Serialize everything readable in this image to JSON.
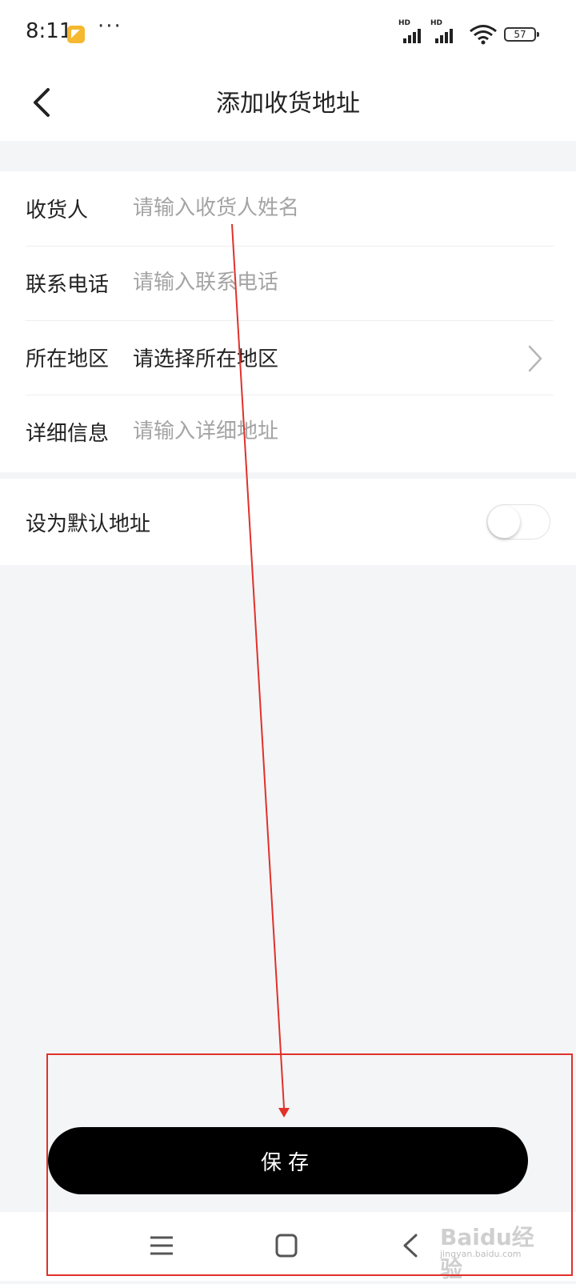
{
  "status_bar": {
    "time": "8:11",
    "dots": "···",
    "signal_label": "HD",
    "battery": "57"
  },
  "header": {
    "title": "添加收货地址"
  },
  "form": {
    "recipient": {
      "label": "收货人",
      "placeholder": "请输入收货人姓名"
    },
    "phone": {
      "label": "联系电话",
      "placeholder": "请输入联系电话"
    },
    "region": {
      "label": "所在地区",
      "value": "请选择所在地区"
    },
    "detail": {
      "label": "详细信息",
      "placeholder": "请输入详细地址"
    }
  },
  "default_address": {
    "label": "设为默认地址",
    "enabled": false
  },
  "save_button": {
    "label": "保存"
  },
  "watermark": {
    "logo": "Baidu经验",
    "sub": "jingyan.baidu.com"
  },
  "colors": {
    "annotation": "#e0312a",
    "primary_button": "#000000",
    "page_background": "#f4f5f7"
  }
}
